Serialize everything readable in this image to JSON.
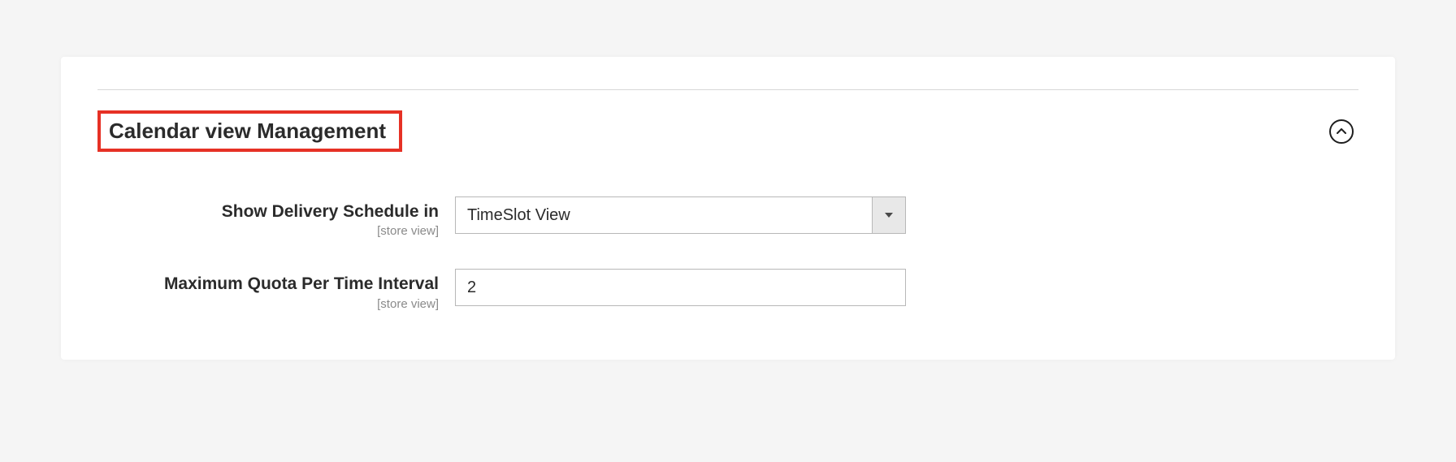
{
  "section": {
    "title": "Calendar view Management"
  },
  "fields": {
    "deliverySchedule": {
      "label": "Show Delivery Schedule in",
      "scope": "[store view]",
      "value": "TimeSlot View"
    },
    "maxQuota": {
      "label": "Maximum Quota Per Time Interval",
      "scope": "[store view]",
      "value": "2"
    }
  }
}
